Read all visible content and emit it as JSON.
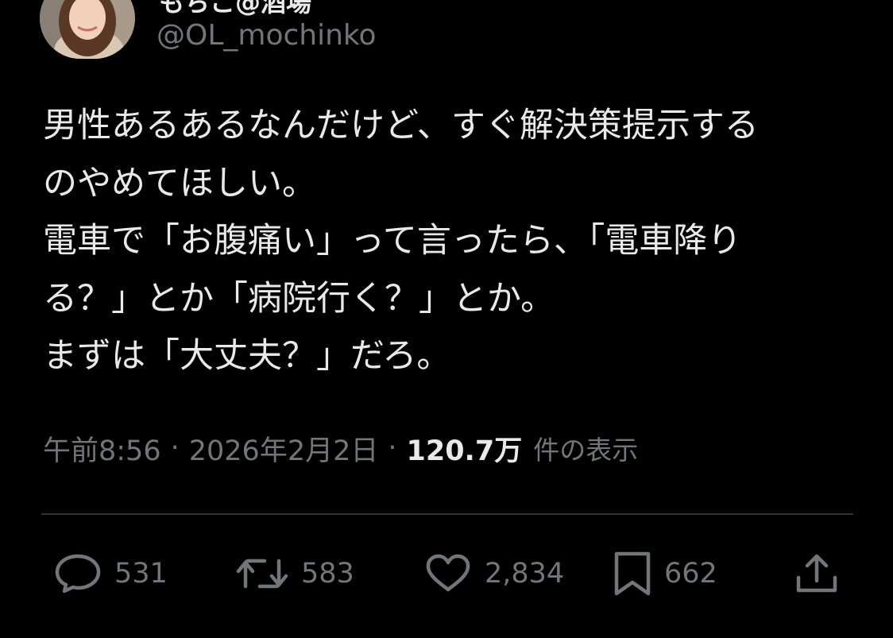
{
  "author": {
    "display_name": "もちこ@酒場",
    "handle": "@OL_mochinko",
    "avatar": "avatar-photo"
  },
  "tweet": {
    "lines": [
      "男性あるあるなんだけど、すぐ解決策提示する",
      "のやめてほしい。",
      "電車で「お腹痛い」って言ったら、「電車降り",
      "る？」とか「病院行く？」とか。",
      "まずは「大丈夫？」だろ。"
    ]
  },
  "meta": {
    "time": "午前8:56",
    "separator": "·",
    "date": "2026年2月2日",
    "views_count": "120.7万",
    "views_label": "件の表示"
  },
  "actions": {
    "reply": {
      "icon": "reply-icon",
      "count": "531"
    },
    "repost": {
      "icon": "repost-icon",
      "count": "583"
    },
    "like": {
      "icon": "heart-icon",
      "count": "2,834"
    },
    "bookmark": {
      "icon": "bookmark-icon",
      "count": "662"
    },
    "share": {
      "icon": "share-icon"
    }
  },
  "colors": {
    "background": "#000000",
    "text_primary": "#e7e9ea",
    "text_secondary": "#71767b",
    "divider": "#2f3336"
  }
}
